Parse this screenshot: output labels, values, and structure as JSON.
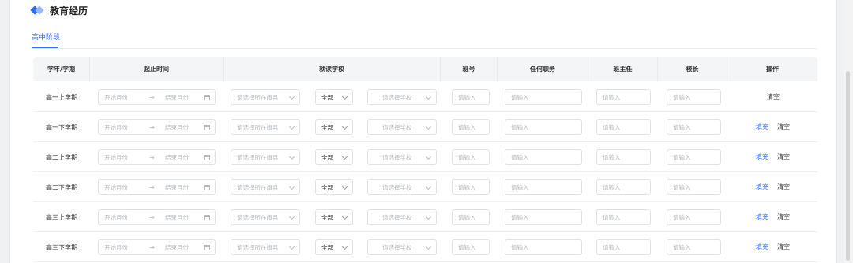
{
  "section": {
    "title": "教育经历",
    "tab": "高中阶段"
  },
  "columns": [
    "学年/学期",
    "起止时间",
    "就读学校",
    "班号",
    "任何职务",
    "班主任",
    "校长",
    "操作"
  ],
  "placeholders": {
    "start_month": "开始月份",
    "range_sep": "→",
    "end_month": "结束月份",
    "region": "请选择所在旗县",
    "school_type": "全部",
    "school": "请选择学校",
    "input": "请输入"
  },
  "actions": {
    "fill": "填充",
    "clear": "清空"
  },
  "rows": [
    {
      "semester": "高一上学期",
      "show_fill": false
    },
    {
      "semester": "高一下学期",
      "show_fill": true
    },
    {
      "semester": "高二上学期",
      "show_fill": true
    },
    {
      "semester": "高二下学期",
      "show_fill": true
    },
    {
      "semester": "高三上学期",
      "show_fill": true
    },
    {
      "semester": "高三下学期",
      "show_fill": true
    }
  ],
  "colors": {
    "accent": "#2f6cf6",
    "header_bg": "#f4f5f7"
  }
}
